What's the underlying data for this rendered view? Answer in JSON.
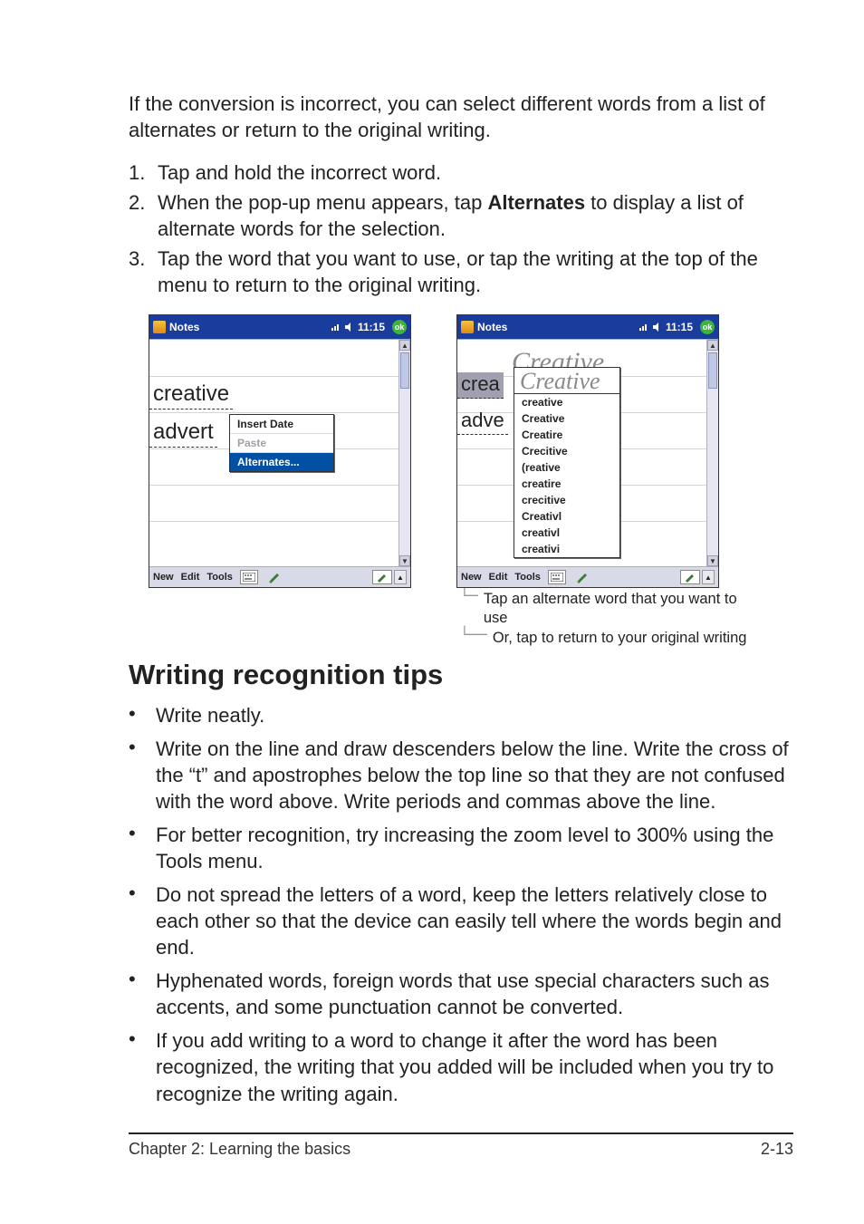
{
  "intro": "If the conversion is incorrect, you can select different words from a list of alternates or return to the original writing.",
  "steps": [
    {
      "num": "1.",
      "text": "Tap and hold the incorrect word."
    },
    {
      "num": "2.",
      "pre": "When the pop-up menu appears, tap ",
      "bold": "Alternates",
      "post": " to display a list of alternate words for the selection."
    },
    {
      "num": "3.",
      "text": "Tap the word that you want to use, or tap the writing at the top of the menu to return to the original writing."
    }
  ],
  "shot1": {
    "title": "Notes",
    "time": "11:15",
    "ok": "ok",
    "word1": "creative",
    "word2": "advert",
    "menu": {
      "insert_date": "Insert Date",
      "paste": "Paste",
      "alternates": "Alternates..."
    },
    "menubar": {
      "new": "New",
      "edit": "Edit",
      "tools": "Tools"
    }
  },
  "shot2": {
    "title": "Notes",
    "time": "11:15",
    "ok": "ok",
    "sel": "crea",
    "word2": "adve",
    "hand": "Creative",
    "alts": [
      "creative",
      "Creative",
      "Creatire",
      "Crecitive",
      "(reative",
      "creatire",
      "crecitive",
      "Creativl",
      "creativl",
      "creativi"
    ],
    "menubar": {
      "new": "New",
      "edit": "Edit",
      "tools": "Tools"
    }
  },
  "callouts": {
    "c1": "Tap an alternate word that you want to use",
    "c2": "Or, tap to return to your original writing"
  },
  "section_heading": "Writing recognition tips",
  "tips": [
    "Write neatly.",
    "Write on the line and draw descenders below the line. Write the cross of the “t” and apostrophes below the top line so that they are not confused with the word above. Write periods and commas above the line.",
    "For better recognition, try increasing the zoom level to 300% using the Tools menu.",
    "Do not spread the letters of a word, keep the letters relatively close to each other so that the device can easily tell where the words begin and end.",
    "Hyphenated words, foreign words that use special characters such as accents, and some punctuation cannot be converted.",
    "If you add writing to a word to change it after the word has been recognized, the writing that you added will be included when you try to recognize the writing again."
  ],
  "footer": {
    "left": "Chapter 2: Learning the basics",
    "right": "2-13"
  }
}
